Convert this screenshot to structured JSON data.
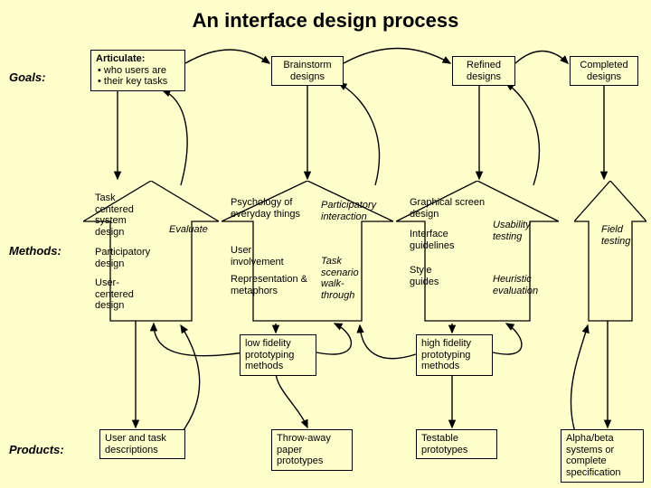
{
  "title": "An interface design process",
  "rows": {
    "goals": "Goals:",
    "methods": "Methods:",
    "products": "Products:"
  },
  "goals": {
    "articulate": {
      "title": "Articulate:",
      "b1": "• who users are",
      "b2": "• their key tasks"
    },
    "brainstorm": "Brainstorm designs",
    "refined": "Refined designs",
    "completed": "Completed designs"
  },
  "methods": {
    "task_centered": "Task centered system design",
    "evaluate": "Evaluate",
    "part_design": "Participatory design",
    "ucd": "User-centered design",
    "psych": "Psychology of everyday things",
    "user_inv": "User involvement",
    "rep_met": "Representation & metaphors",
    "part_int": "Participatory interaction",
    "task_scen": "Task scenario walk-through",
    "gsd": "Graphical screen design",
    "ifg": "Interface guidelines",
    "style": "Style guides",
    "usab": "Usability testing",
    "heur": "Heuristic evaluation",
    "field": "Field testing",
    "lofi": "low fidelity prototyping methods",
    "hifi": "high fidelity prototyping methods"
  },
  "products": {
    "utd": "User and task descriptions",
    "throwaway": "Throw-away paper prototypes",
    "testable": "Testable prototypes",
    "alpha": "Alpha/beta systems or complete specification"
  }
}
